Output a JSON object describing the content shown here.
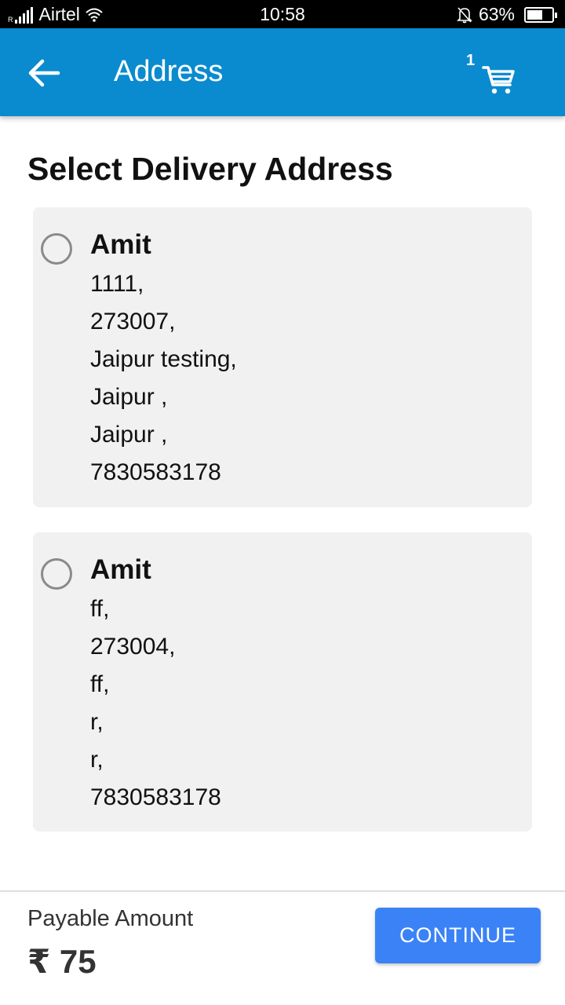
{
  "status_bar": {
    "carrier": "Airtel",
    "time": "10:58",
    "battery": "63%",
    "battery_level": 0.63
  },
  "header": {
    "title": "Address",
    "cart_count": "1",
    "back_icon": "arrow-left-icon",
    "cart_icon": "cart-icon",
    "color": "#0a8bcf"
  },
  "main": {
    "title": "Select Delivery Address",
    "addresses": [
      {
        "name": "Amit",
        "lines": [
          "1111,",
          "273007,",
          "Jaipur testing,",
          "Jaipur ,",
          "Jaipur ,",
          "7830583178"
        ],
        "selected": false
      },
      {
        "name": "Amit",
        "lines": [
          "ff,",
          "273004,",
          "ff,",
          "r,",
          "r,",
          "7830583178"
        ],
        "selected": false
      }
    ]
  },
  "footer": {
    "payable_label": "Payable Amount",
    "payable_amount": "₹ 75",
    "continue_label": "CONTINUE",
    "button_color": "#3b82f6"
  }
}
